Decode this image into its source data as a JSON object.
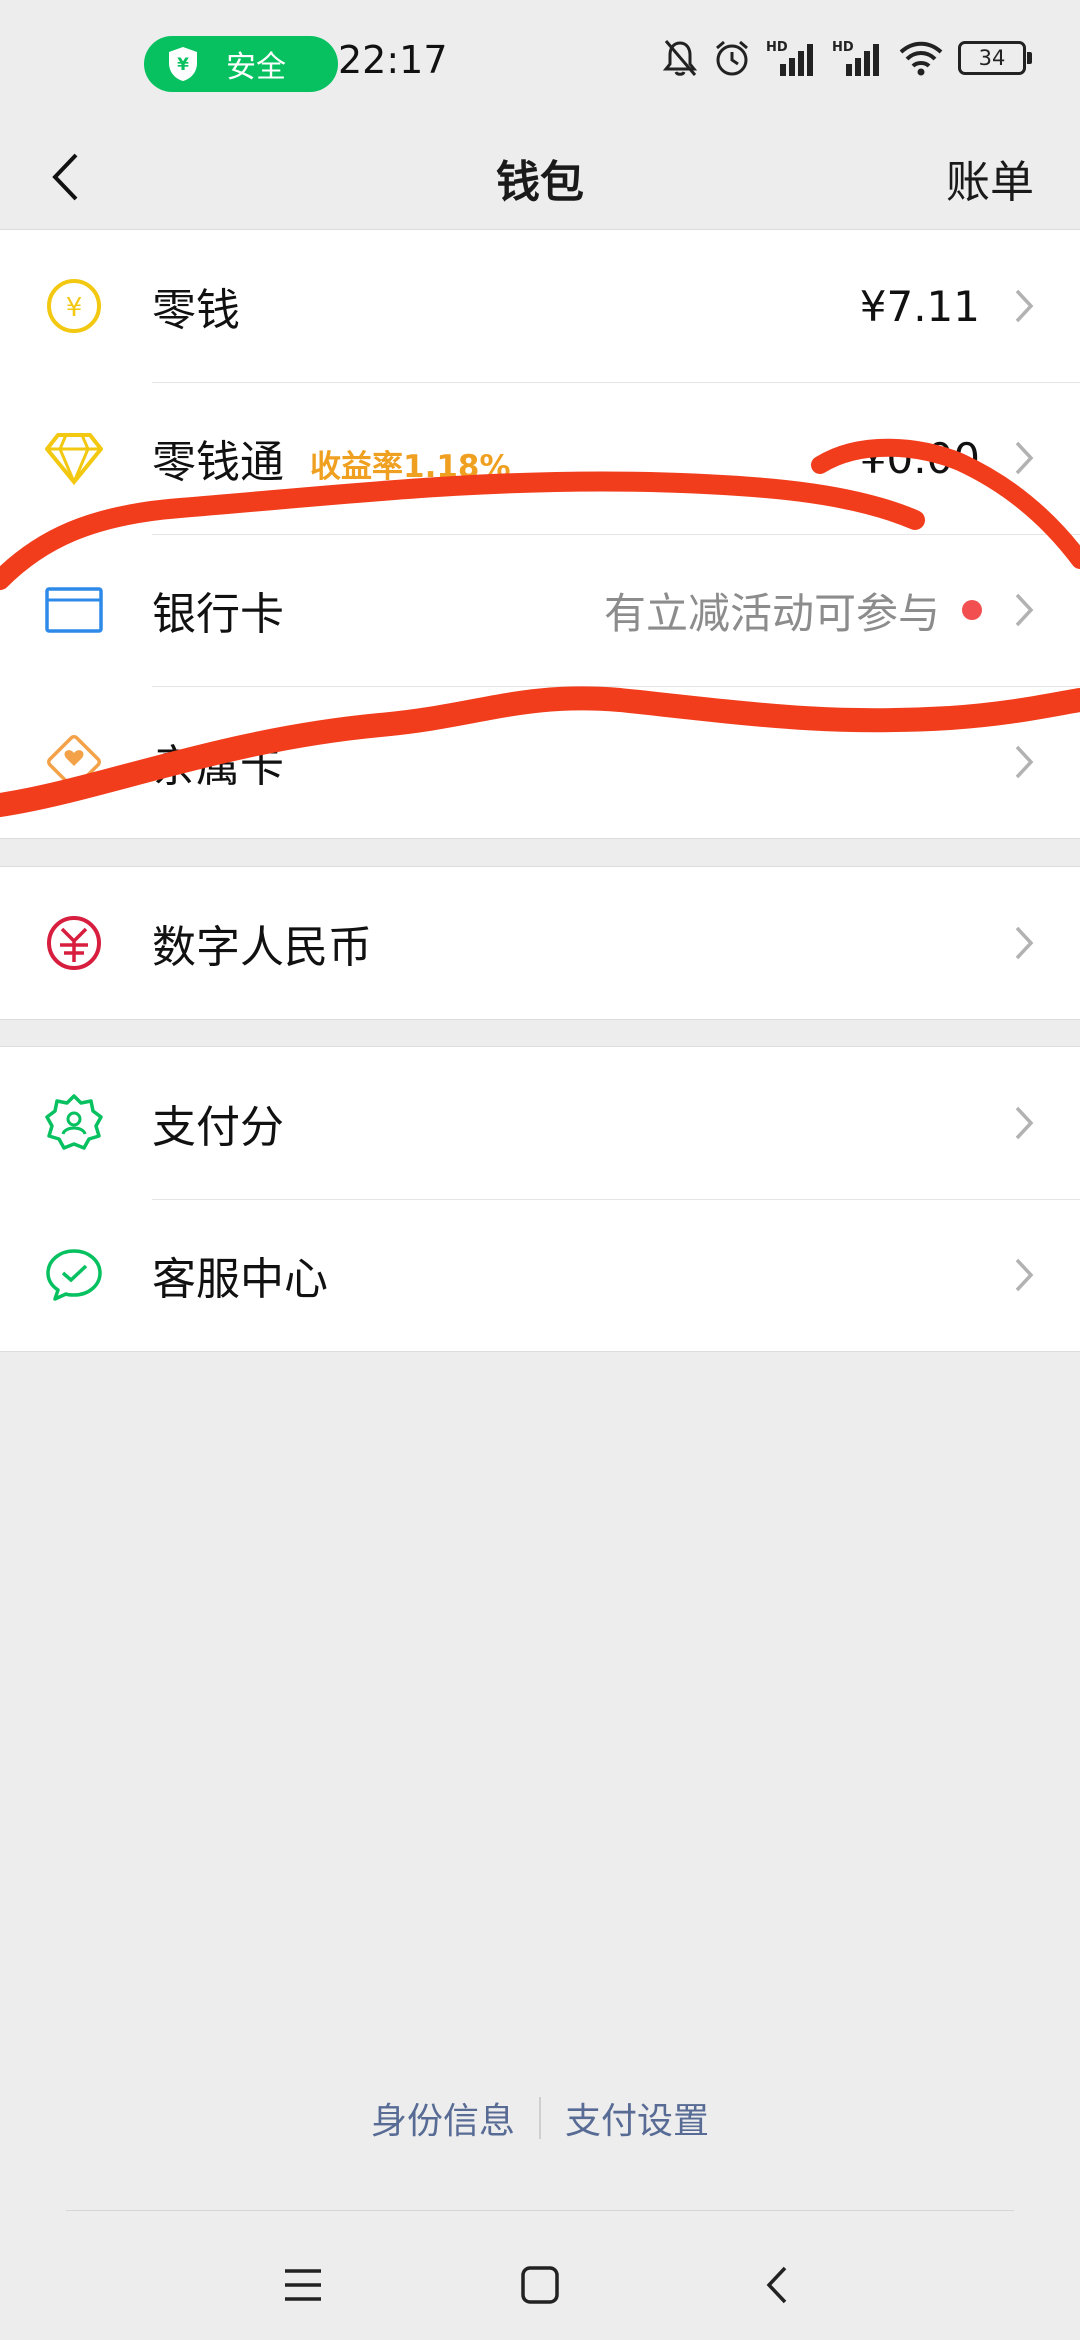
{
  "status_bar": {
    "safety_label": "安全",
    "time": "22:17",
    "battery": "34",
    "hd1": "HD",
    "hd2": "HD"
  },
  "nav": {
    "title": "钱包",
    "right_action": "账单"
  },
  "groups": [
    {
      "items": [
        {
          "label": "零钱",
          "value": "¥7.11",
          "icon": "yen-coin-icon"
        },
        {
          "label": "零钱通",
          "tag": "收益率1.18%",
          "value": "¥0.00",
          "icon": "diamond-icon"
        },
        {
          "label": "银行卡",
          "hint": "有立减活动可参与",
          "icon": "bank-card-icon",
          "has_red_dot": true
        },
        {
          "label": "亲属卡",
          "icon": "family-card-icon"
        }
      ]
    },
    {
      "items": [
        {
          "label": "数字人民币",
          "icon": "digital-rmb-icon"
        }
      ]
    },
    {
      "items": [
        {
          "label": "支付分",
          "icon": "pay-score-icon"
        },
        {
          "label": "客服中心",
          "icon": "customer-service-icon"
        }
      ]
    }
  ],
  "footer": {
    "identity_link": "身份信息",
    "settings_link": "支付设置"
  },
  "colors": {
    "accent_green": "#07c160",
    "yen_yellow": "#f2c811",
    "tag_orange": "#f0a020",
    "card_blue": "#2d8ae8",
    "rmb_red": "#d81e3f",
    "link_blue": "#576b95",
    "scribble_red": "#f23d1c"
  }
}
